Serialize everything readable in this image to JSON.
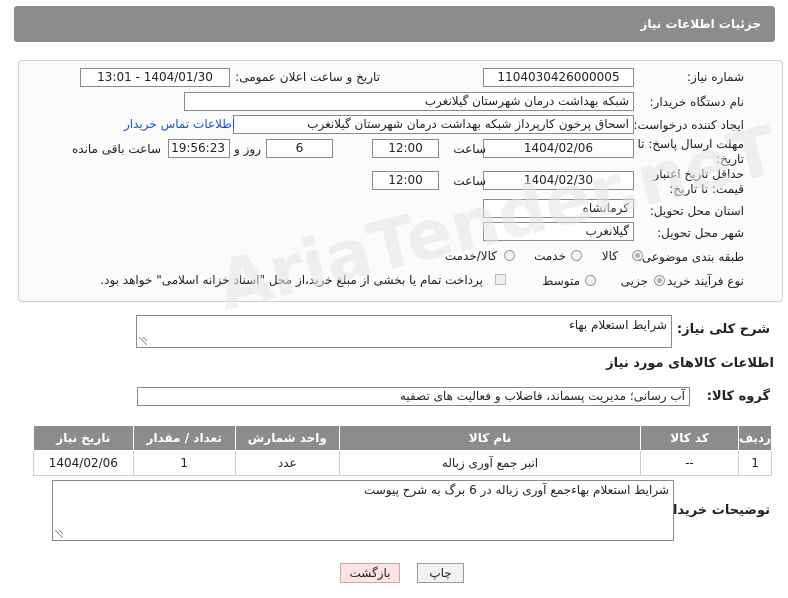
{
  "header": {
    "title": "جزئیات اطلاعات نیاز"
  },
  "form": {
    "need_number_label": "شماره نیاز:",
    "need_number": "1104030426000005",
    "announce_label": "تاریخ و ساعت اعلان عمومی:",
    "announce_value": "1404/01/30 - 13:01",
    "buyer_org_label": "نام دستگاه خریدار:",
    "buyer_org": "شبکه بهداشت درمان شهرستان گیلانغرب",
    "creator_label": "ایجاد کننده درخواست:",
    "creator": "اسحاق پرخون کارپرداز شبکه بهداشت درمان شهرستان گیلانغرب",
    "contact_link": "اطلاعات تماس خریدار",
    "deadline_label": "مهلت ارسال پاسخ: تا تاریخ:",
    "deadline_date": "1404/02/06",
    "time_label": "ساعت",
    "deadline_time": "12:00",
    "days_value": "6",
    "days_label": "روز و",
    "remaining_time": "19:56:23",
    "remaining_label": "ساعت باقی مانده",
    "price_validity_label": "حداقل تاریخ اعتبار قیمت: تا تاریخ:",
    "price_date": "1404/02/30",
    "price_time": "12:00",
    "province_label": "استان محل تحویل:",
    "province": "کرمانشاه",
    "city_label": "شهر محل تحویل:",
    "city": "گیلانغرب",
    "category_label": "طبقه بندی موضوعی:",
    "category_options": [
      "کالا",
      "خدمت",
      "کالا/خدمت"
    ],
    "process_label": "نوع فرآیند خرید :",
    "process_options": [
      "جزیی",
      "متوسط"
    ],
    "payment_note": "پرداخت تمام یا بخشی از مبلغ خرید،از محل \"اسناد خزانه اسلامی\" خواهد بود."
  },
  "description": {
    "label": "شرح کلی نیاز:",
    "value": "شرایط استعلام بهاء"
  },
  "goods_section": {
    "title": "اطلاعات کالاهای مورد نیاز",
    "group_label": "گروه کالا:",
    "group_value": "آب رسانی؛ مدیریت پسماند، فاضلاب و فعالیت های تصفیه"
  },
  "table": {
    "headers": [
      "ردیف",
      "کد کالا",
      "نام کالا",
      "واحد شمارش",
      "تعداد / مقدار",
      "تاریخ نیاز"
    ],
    "rows": [
      [
        "1",
        "--",
        "انبر جمع آوری زباله",
        "عدد",
        "1",
        "1404/02/06"
      ]
    ]
  },
  "buyer_notes": {
    "label": "توضیحات خریدار:",
    "value": "شرایط استعلام بهاءجمع آوری زباله در 6 برگ به شرح پیوست"
  },
  "buttons": {
    "print": "چاپ",
    "back": "بازگشت"
  },
  "watermark": "AriaTender.neT",
  "colors": {
    "header_bg": "#8c8c8c",
    "link": "#1a55c8",
    "back_button_bg": "#fde3e3"
  }
}
